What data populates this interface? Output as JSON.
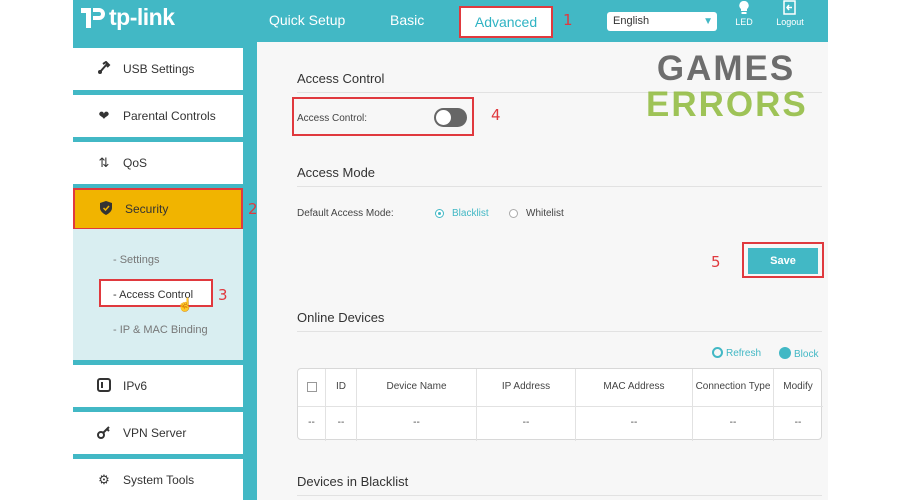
{
  "header": {
    "logo_text": "tp-link",
    "tabs": [
      {
        "label": "Quick Setup"
      },
      {
        "label": "Basic"
      },
      {
        "label": "Advanced",
        "active": true
      }
    ],
    "language": "English",
    "icons": [
      {
        "label": "LED",
        "icon": "lightbulb-icon"
      },
      {
        "label": "Logout",
        "icon": "logout-icon"
      }
    ]
  },
  "sidebar": {
    "items": [
      {
        "label": "USB Settings",
        "icon": "usb-icon"
      },
      {
        "label": "Parental Controls",
        "icon": "heart-icon"
      },
      {
        "label": "QoS",
        "icon": "qos-arrows-icon"
      },
      {
        "label": "Security",
        "icon": "shield-icon",
        "active": true
      },
      {
        "label": "IPv6",
        "icon": "ipv6-icon"
      },
      {
        "label": "VPN Server",
        "icon": "vpn-key-icon"
      },
      {
        "label": "System Tools",
        "icon": "gear-icon"
      }
    ],
    "submenu": [
      {
        "label": "- Settings"
      },
      {
        "label": "- Access Control",
        "active": true
      },
      {
        "label": "- IP & MAC Binding"
      }
    ]
  },
  "content": {
    "access_control": {
      "title": "Access Control",
      "toggle_label": "Access Control:",
      "enabled": false
    },
    "access_mode": {
      "title": "Access Mode",
      "label": "Default Access Mode:",
      "options": [
        "Blacklist",
        "Whitelist"
      ],
      "selected": "Blacklist"
    },
    "save_label": "Save",
    "online_devices": {
      "title": "Online Devices",
      "refresh_label": "Refresh",
      "block_label": "Block",
      "columns": [
        "ID",
        "Device Name",
        "IP Address",
        "MAC Address",
        "Connection Type",
        "Modify"
      ],
      "rows": [
        [
          "--",
          "--",
          "--",
          "--",
          "--",
          "--",
          "--"
        ]
      ]
    },
    "blacklist_title": "Devices in Blacklist"
  },
  "annotations": [
    "1",
    "2",
    "3",
    "4",
    "5"
  ],
  "watermark": {
    "line1": "GAMES",
    "line2": "ERRORS"
  },
  "colors": {
    "brand": "#42b8c5",
    "highlight": "#f1b400",
    "annotation": "#e0393e",
    "watermark_green": "#8fba3c"
  }
}
